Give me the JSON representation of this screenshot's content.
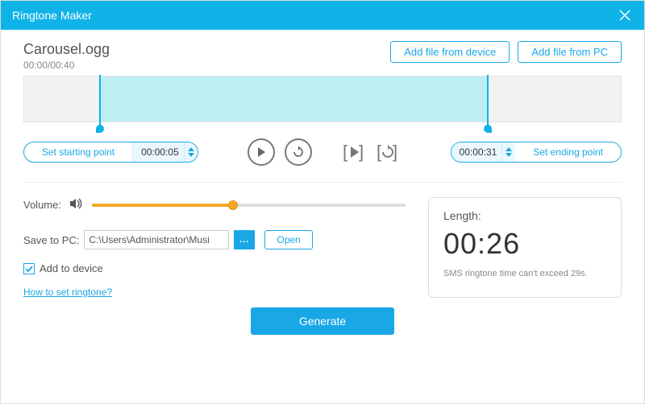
{
  "window": {
    "title": "Ringtone Maker"
  },
  "file": {
    "name": "Carousel.ogg",
    "position": "00:00",
    "duration": "00:40"
  },
  "buttons": {
    "add_device": "Add file from device",
    "add_pc": "Add file from PC",
    "set_start": "Set starting point",
    "set_end": "Set ending point",
    "open": "Open",
    "generate": "Generate",
    "browse": "..."
  },
  "times": {
    "start": "00:00:05",
    "end": "00:00:31"
  },
  "waveform": {
    "start_pct": 12.5,
    "end_pct": 77.5
  },
  "volume": {
    "label": "Volume:",
    "value_pct": 45
  },
  "save": {
    "label": "Save to PC:",
    "path": "C:\\Users\\Administrator\\Musi"
  },
  "add_to_device": {
    "label": "Add to device",
    "checked": true
  },
  "help_link": "How to set ringtone?",
  "length_card": {
    "label": "Length:",
    "value": "00:26",
    "note": "SMS ringtone time can't exceed 29s."
  }
}
